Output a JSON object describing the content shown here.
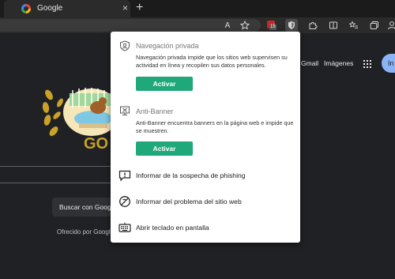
{
  "tab": {
    "title": "Google",
    "close": "×",
    "new_tab": "+"
  },
  "toolbar": {
    "reader_label": "A",
    "ext_badge_count": "15"
  },
  "google": {
    "gmail": "Gmail",
    "images": "Imágenes",
    "signin_partial": "In",
    "search_button_partial": "Buscar con Goog",
    "offered_partial": "Ofrecido por Google",
    "doodle_text": "GO"
  },
  "popup": {
    "private": {
      "title": "Navegación privada",
      "description": "Navegación privada impide que los sitios web supervisen su actividad en línea y recopilen sus datos personales.",
      "button": "Activar"
    },
    "antibanner": {
      "title": "Anti-Banner",
      "description": "Anti-Banner encuentra banners en la página web e impide que se muestren.",
      "button": "Activar"
    },
    "menu": [
      {
        "label": "Informar de la sospecha de phishing",
        "icon": "message-alert-icon"
      },
      {
        "label": "Informar del problema del sitio web",
        "icon": "no-entry-icon"
      },
      {
        "label": "Abrir teclado en pantalla",
        "icon": "keyboard-icon"
      }
    ]
  },
  "colors": {
    "accent": "#1fa87a",
    "background": "#202124",
    "popup": "#ffffff"
  }
}
